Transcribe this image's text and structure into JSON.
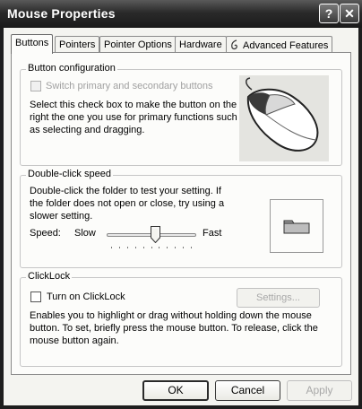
{
  "window": {
    "title": "Mouse Properties",
    "help_glyph": "?",
    "close_glyph": "✕"
  },
  "tabs": [
    {
      "label": "Buttons",
      "active": true
    },
    {
      "label": "Pointers",
      "active": false
    },
    {
      "label": "Pointer Options",
      "active": false
    },
    {
      "label": "Hardware",
      "active": false
    },
    {
      "label": "Advanced Features",
      "active": false
    }
  ],
  "button_config": {
    "legend": "Button configuration",
    "checkbox_label": "Switch primary and secondary buttons",
    "checked": false,
    "description": "Select this check box to make the button on the right the one you use for primary functions such as selecting and dragging."
  },
  "double_click": {
    "legend": "Double-click speed",
    "description": "Double-click the folder to test your setting. If the folder does not open or close, try using a slower setting.",
    "speed_label": "Speed:",
    "slow_label": "Slow",
    "fast_label": "Fast",
    "slider_value": 0.55
  },
  "clicklock": {
    "legend": "ClickLock",
    "checkbox_label": "Turn on ClickLock",
    "checked": false,
    "settings_button": "Settings...",
    "description": "Enables you to highlight or drag without holding down the mouse button. To set, briefly press the mouse button. To release, click the mouse button again."
  },
  "footer": {
    "ok": "OK",
    "cancel": "Cancel",
    "apply": "Apply"
  }
}
